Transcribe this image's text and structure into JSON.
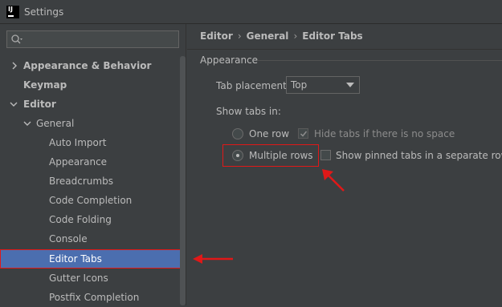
{
  "window": {
    "title": "Settings",
    "app_icon_text": "IJ"
  },
  "sidebar": {
    "search_placeholder": "",
    "items": [
      {
        "label": "Appearance & Behavior",
        "expanded": false
      },
      {
        "label": "Keymap"
      },
      {
        "label": "Editor",
        "expanded": true
      },
      {
        "label": "General",
        "expanded": true
      },
      {
        "label": "Auto Import"
      },
      {
        "label": "Appearance"
      },
      {
        "label": "Breadcrumbs"
      },
      {
        "label": "Code Completion"
      },
      {
        "label": "Code Folding"
      },
      {
        "label": "Console"
      },
      {
        "label": "Editor Tabs",
        "selected": true
      },
      {
        "label": "Gutter Icons"
      },
      {
        "label": "Postfix Completion"
      }
    ]
  },
  "breadcrumb": [
    "Editor",
    "General",
    "Editor Tabs"
  ],
  "appearance": {
    "section_title": "Appearance",
    "tab_placement_label": "Tab placement:",
    "tab_placement_value": "Top",
    "show_tabs_label": "Show tabs in:",
    "one_row_label": "One row",
    "one_row_selected": false,
    "hide_tabs_label": "Hide tabs if there is no space",
    "hide_tabs_checked": true,
    "hide_tabs_enabled": false,
    "multiple_rows_label": "Multiple rows",
    "multiple_rows_selected": true,
    "pinned_separate_label": "Show pinned tabs in a separate row",
    "pinned_separate_checked": false
  },
  "colors": {
    "background": "#3c3f41",
    "selection": "#4b6eaf",
    "annotation": "#e01818",
    "text": "#bbbbbb"
  },
  "icons": [
    "search-icon",
    "chevron-right-icon",
    "chevron-down-icon",
    "dropdown-arrow-icon",
    "checkmark-icon"
  ]
}
